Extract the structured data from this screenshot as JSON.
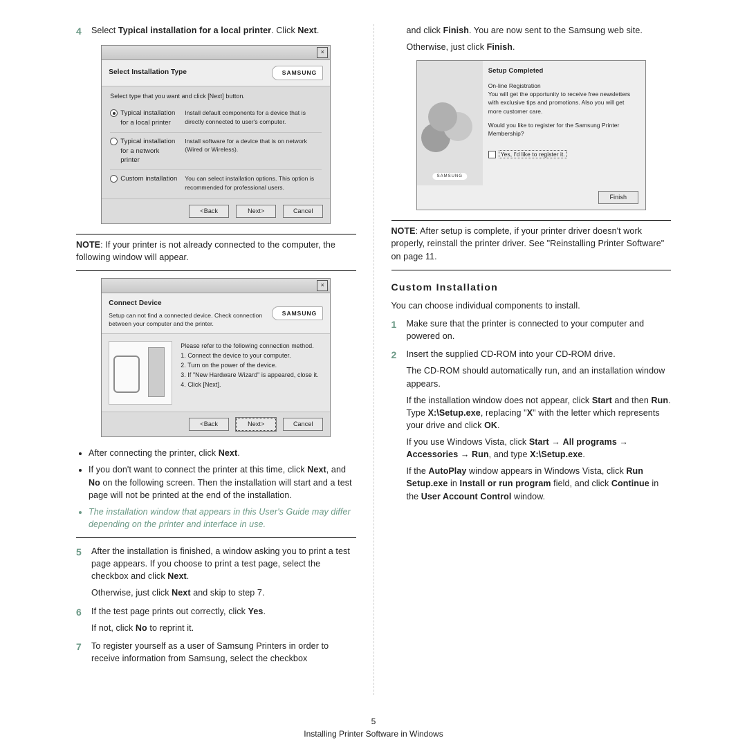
{
  "left": {
    "step4_num": "4",
    "step4_text_a": "Select ",
    "step4_text_b": "Typical installation for a local printer",
    "step4_text_c": ". Click ",
    "step4_text_d": "Next",
    "step4_text_e": ".",
    "dlg1": {
      "title": "Select Installation Type",
      "logo": "SAMSUNG",
      "hint": "Select type that you want and click [Next] button.",
      "opt1": "Typical installation for a local printer",
      "opt1d": "Install default components for a device that is directly connected to user's computer.",
      "opt2": "Typical installation for a network printer",
      "opt2d": "Install software for a device that is on network (Wired or Wireless).",
      "opt3": "Custom installation",
      "opt3d": "You can select installation options. This option is recommended for professional users.",
      "back": "<Back",
      "next": "Next>",
      "cancel": "Cancel"
    },
    "note1_a": "NOTE",
    "note1_b": ": If your printer is not already connected to the computer, the following window will appear.",
    "dlg2": {
      "title": "Connect Device",
      "sub": "Setup can not find a connected device. Check connection between your computer and the printer.",
      "logo": "SAMSUNG",
      "l0": "Please refer to the following connection method.",
      "l1": "1. Connect the device to your computer.",
      "l2": "2. Turn on the power of the device.",
      "l3": "3. If \"New Hardware Wizard\" is appeared, close it.",
      "l4": "4. Click [Next].",
      "back": "<Back",
      "next": "Next>",
      "cancel": "Cancel"
    },
    "b1": "After connecting the printer, click ",
    "b1b": "Next",
    "b1c": ".",
    "b2a": "If you don't want to connect the printer at this time, click ",
    "b2b": "Next",
    "b2c": ", and ",
    "b2d": "No",
    "b2e": " on the following screen. Then the installation will start and a test page will not be printed at the end of the installation.",
    "b3": "The installation window that appears in this User's Guide may differ depending on the printer and interface in use.",
    "step5_num": "5",
    "s5a": "After the installation is finished, a window asking you to print a test page appears. If you choose to print a test page, select the checkbox and click ",
    "s5b": "Next",
    "s5c": ".",
    "s5d": "Otherwise, just click ",
    "s5e": "Next",
    "s5f": " and skip to step 7.",
    "step6_num": "6",
    "s6a": "If the test page prints out correctly, click ",
    "s6b": "Yes",
    "s6c": ".",
    "s6d": "If not, click ",
    "s6e": "No",
    "s6f": " to reprint it.",
    "step7_num": "7",
    "s7": "To register yourself as a user of Samsung Printers in order to receive information from Samsung, select the checkbox"
  },
  "right": {
    "cont_a": "and click ",
    "cont_b": "Finish",
    "cont_c": ". You are now sent to the Samsung web site.",
    "cont_d": "Otherwise, just click ",
    "cont_e": "Finish",
    "cont_f": ".",
    "dlg3": {
      "title": "Setup Completed",
      "reg": "On-line Registration",
      "regd": "You will get the opportunity to receive free newsletters with exclusive tips and promotions. Also you will get more customer care.",
      "q": "Would you like to register for the Samsung Printer Membership?",
      "chk": "Yes, I'd like to register it.",
      "finish": "Finish",
      "logo": "SAMSUNG"
    },
    "note2_a": "NOTE",
    "note2_b": ": After setup is complete, if your printer driver doesn't work properly, reinstall the printer driver. See \"Reinstalling Printer Software\" on page 11.",
    "section": "Custom Installation",
    "intro": "You can choose individual components to install.",
    "s1n": "1",
    "s1": "Make sure that the printer is connected to your computer and powered on.",
    "s2n": "2",
    "s2a": "Insert the supplied CD-ROM into your CD-ROM drive.",
    "s2b": "The CD-ROM should automatically run, and an installation window appears.",
    "s2c_a": "If the installation window does not appear, click ",
    "s2c_b": "Start",
    "s2c_c": " and then ",
    "s2c_d": "Run",
    "s2c_e": ". Type ",
    "s2c_f": "X:\\Setup.exe",
    "s2c_g": ", replacing \"",
    "s2c_h": "X",
    "s2c_i": "\" with the letter which represents your drive and click ",
    "s2c_j": "OK",
    "s2c_k": ".",
    "s2d_a": "If you use Windows Vista, click ",
    "s2d_b": "Start",
    "s2d_c": " → ",
    "s2d_d": "All programs",
    "s2d_e": " → ",
    "s2d_f": "Accessories",
    "s2d_g": " → ",
    "s2d_h": "Run",
    "s2d_i": ", and type ",
    "s2d_j": "X:\\Setup.exe",
    "s2d_k": ".",
    "s2e_a": "If the ",
    "s2e_b": "AutoPlay",
    "s2e_c": " window appears in Windows Vista, click ",
    "s2e_d": "Run Setup.exe",
    "s2e_e": " in ",
    "s2e_f": "Install or run program",
    "s2e_g": " field, and click ",
    "s2e_h": "Continue",
    "s2e_i": " in the ",
    "s2e_j": "User Account Control",
    "s2e_k": " window."
  },
  "footer": {
    "page": "5",
    "running": "Installing Printer Software in Windows"
  }
}
